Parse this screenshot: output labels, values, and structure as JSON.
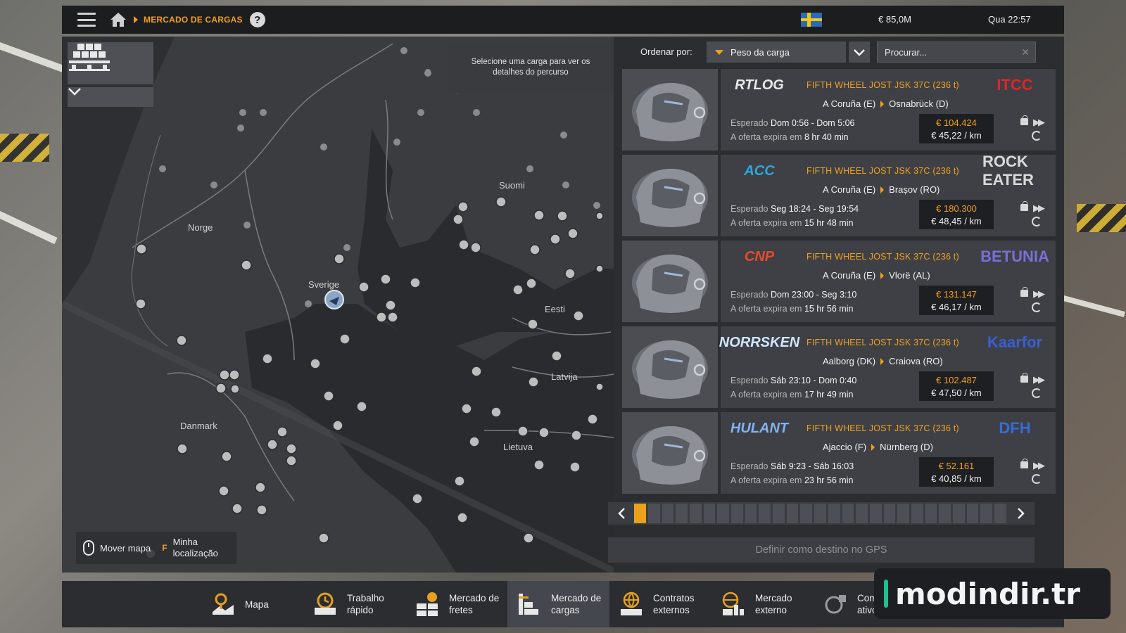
{
  "header": {
    "breadcrumb": "MERCADO DE CARGAS",
    "help": "?",
    "money": "€ 85,0M",
    "clock": "Qua 22:57",
    "flag_colors": {
      "blue": "#2a6bb6",
      "yellow": "#f2c518"
    }
  },
  "map": {
    "route_hint": "Selecione uma carga para ver os detalhes do percurso",
    "labels": [
      "Norge",
      "Sverige",
      "Suomi",
      "Eesti",
      "Latvija",
      "Danmark",
      "Lietuva"
    ],
    "controls": {
      "move": "Mover mapa",
      "location_key": "F",
      "location": "Minha\nlocalização"
    }
  },
  "sort": {
    "label": "Ordenar por:",
    "selected": "Peso da carga",
    "search_placeholder": "Procurar..."
  },
  "jobs": [
    {
      "company": "RTLOG",
      "company_color": "#e8e8e8",
      "cargo": "FIFTH WHEEL JOST JSK 37C (236 t)",
      "origin": "A Coruña (E)",
      "destination": "Osnabrück (D)",
      "eta_label": "Esperado",
      "eta": "Dom 0:56 - Dom 5:06",
      "expiry_label": "A oferta expira em",
      "expiry": "8 hr 40 min",
      "price": "€ 104.424",
      "per_km": "€ 45,22 / km",
      "dest_company": "ITCC",
      "dest_color": "#e0242a"
    },
    {
      "company": "ACC",
      "company_color": "#2aa8e0",
      "cargo": "FIFTH WHEEL JOST JSK 37C (236 t)",
      "origin": "A Coruña (E)",
      "destination": "Brașov (RO)",
      "eta_label": "Esperado",
      "eta": "Seg 18:24 - Seg 19:54",
      "expiry_label": "A oferta expira em",
      "expiry": "15 hr 48 min",
      "price": "€ 180.300",
      "per_km": "€ 48,45 / km",
      "dest_company": "ROCK EATER",
      "dest_color": "#d9d9d9"
    },
    {
      "company": "CNP",
      "company_color": "#e84a2a",
      "cargo": "FIFTH WHEEL JOST JSK 37C (236 t)",
      "origin": "A Coruña (E)",
      "destination": "Vlorë (AL)",
      "eta_label": "Esperado",
      "eta": "Dom 23:00 - Seg 3:10",
      "expiry_label": "A oferta expira em",
      "expiry": "15 hr 56 min",
      "price": "€ 131.147",
      "per_km": "€ 46,17 / km",
      "dest_company": "BETUNIA",
      "dest_color": "#7a6fd6"
    },
    {
      "company": "NORRSKEN",
      "company_color": "#cfe6ff",
      "cargo": "FIFTH WHEEL JOST JSK 37C (236 t)",
      "origin": "Aalborg (DK)",
      "destination": "Craiova (RO)",
      "eta_label": "Esperado",
      "eta": "Sáb 23:10 - Dom 0:40",
      "expiry_label": "A oferta expira em",
      "expiry": "17 hr 49 min",
      "price": "€ 102.487",
      "per_km": "€ 47,50 / km",
      "dest_company": "Kaarfor",
      "dest_color": "#3a5fd0"
    },
    {
      "company": "HULANT",
      "company_color": "#7fb4f0",
      "cargo": "FIFTH WHEEL JOST JSK 37C (236 t)",
      "origin": "Ajaccio (F)",
      "destination": "Nürnberg (D)",
      "eta_label": "Esperado",
      "eta": "Sáb 9:23 - Sáb 16:03",
      "expiry_label": "A oferta expira em",
      "expiry": "23 hr 56 min",
      "price": "€ 52.161",
      "per_km": "€ 40,85 / km",
      "dest_company": "DFH",
      "dest_color": "#3a6ad8"
    }
  ],
  "pager": {
    "current_page": 1,
    "total_pages": 27
  },
  "gps_button": "Definir como destino no GPS",
  "bottom_nav": [
    {
      "label": "Mapa",
      "icon": "map-icon",
      "active": false
    },
    {
      "label": "Trabalho\nrápido",
      "icon": "quick-job-icon",
      "active": false
    },
    {
      "label": "Mercado de\nfretes",
      "icon": "freight-market-icon",
      "active": false
    },
    {
      "label": "Mercado de\ncargas",
      "icon": "cargo-market-icon",
      "active": true
    },
    {
      "label": "Contratos\nexternos",
      "icon": "external-contracts-icon",
      "active": false
    },
    {
      "label": "Mercado\nexterno",
      "icon": "external-market-icon",
      "active": false
    },
    {
      "label": "Com\nativo",
      "icon": "active-job-icon",
      "active": false
    }
  ],
  "watermark": "modindir.tr",
  "accent": "#f0a020"
}
